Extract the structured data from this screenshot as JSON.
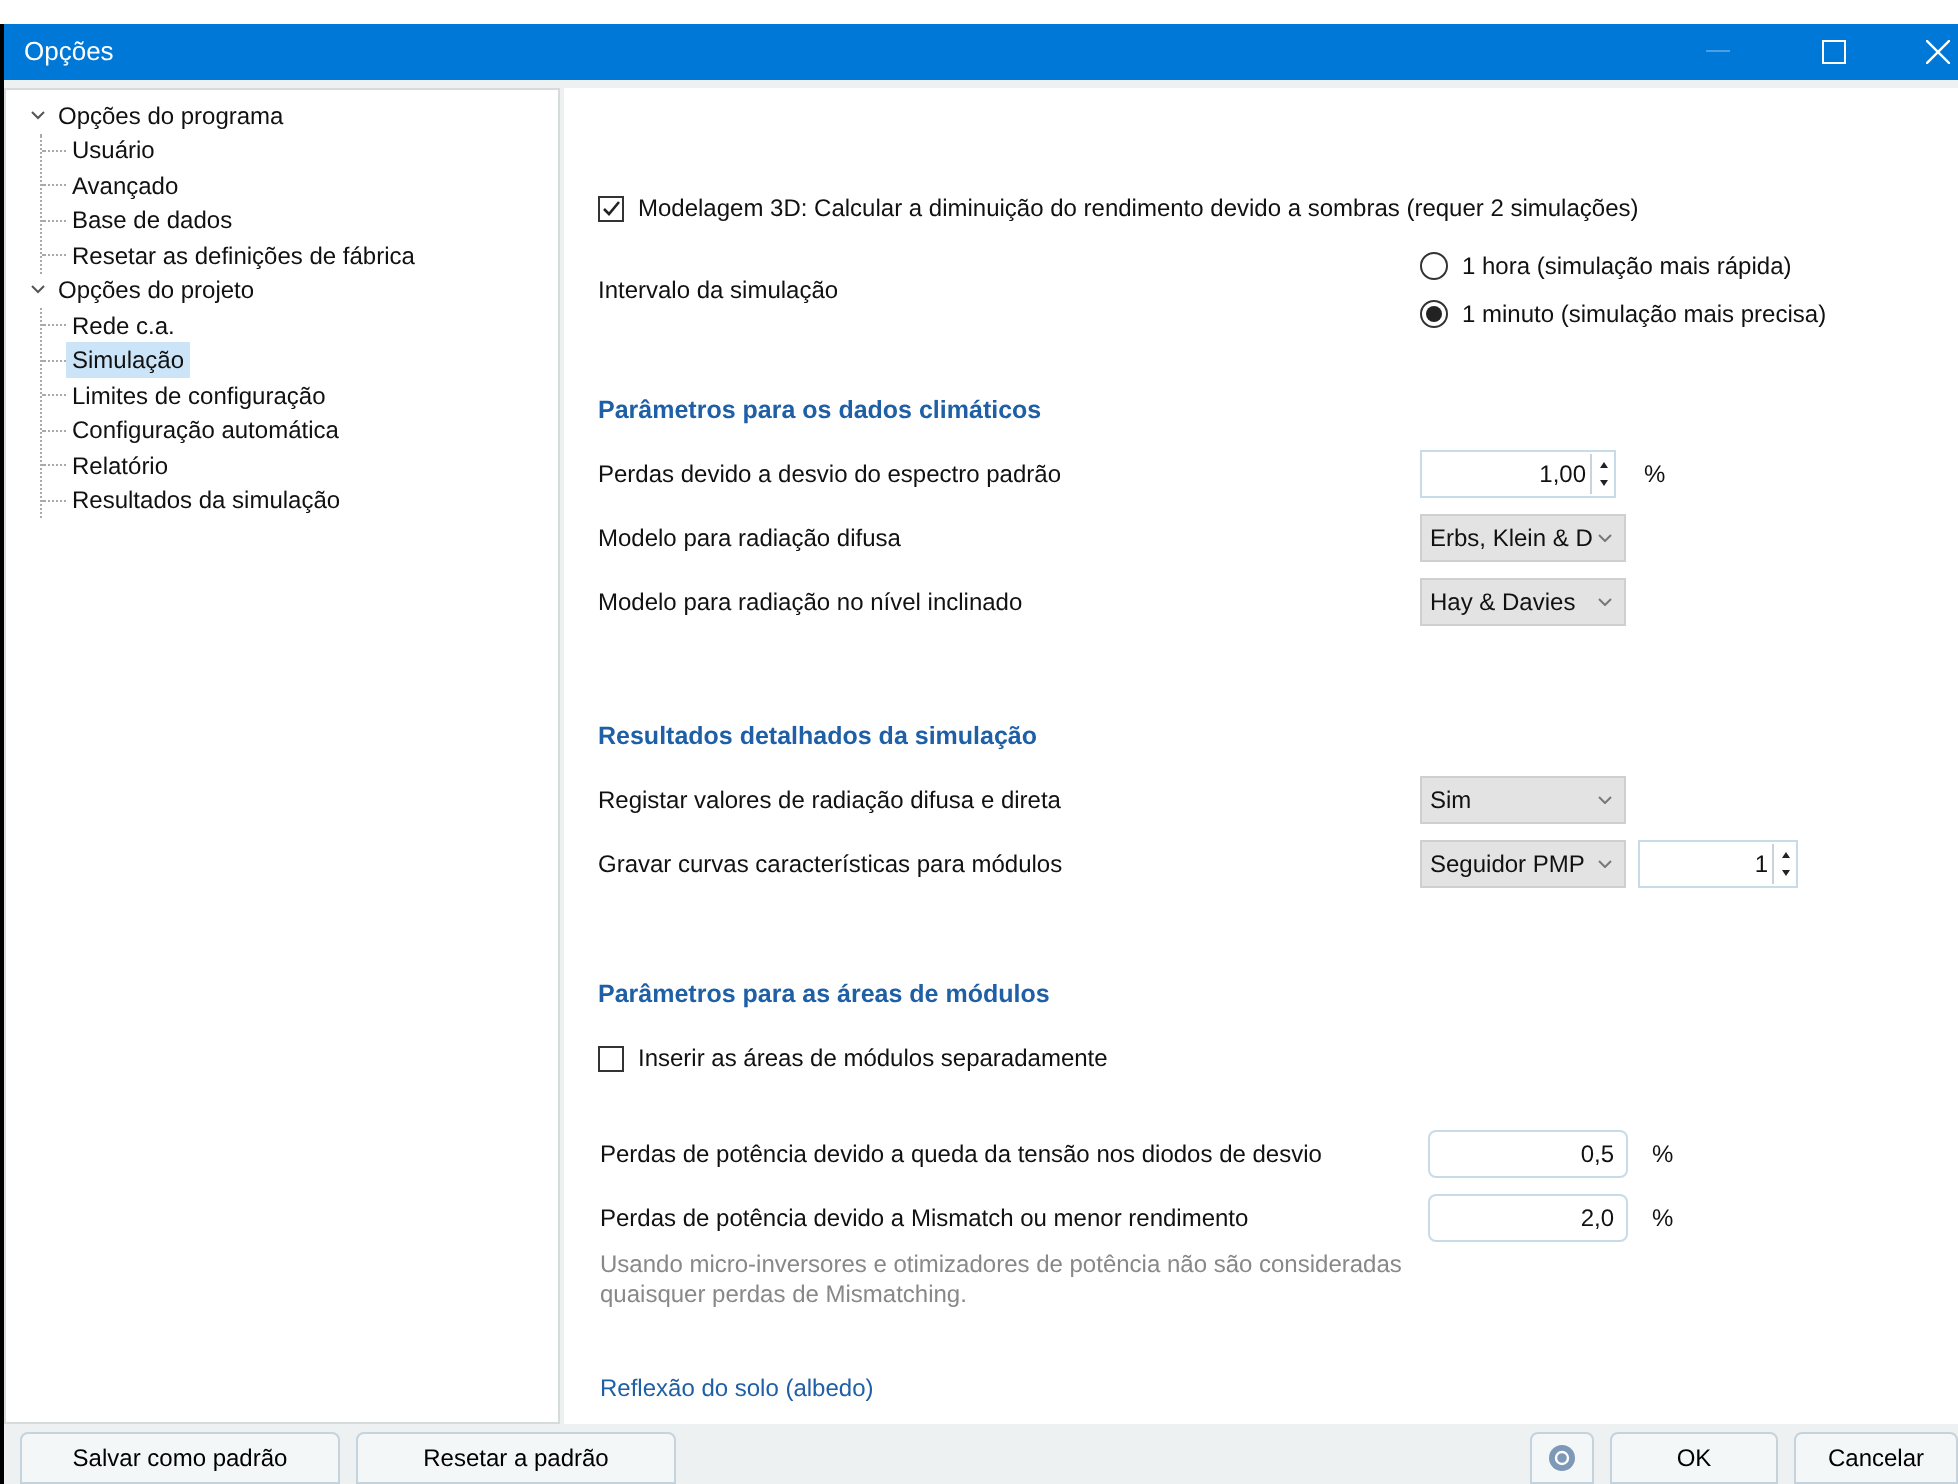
{
  "window": {
    "title": "Opções"
  },
  "tree": [
    {
      "label": "Opções do programa",
      "expanded": true,
      "children": [
        {
          "label": "Usuário",
          "selected": false
        },
        {
          "label": "Avançado",
          "selected": false
        },
        {
          "label": "Base de dados",
          "selected": false
        },
        {
          "label": "Resetar as definições de fábrica",
          "selected": false
        }
      ]
    },
    {
      "label": "Opções do projeto",
      "expanded": true,
      "children": [
        {
          "label": "Rede c.a.",
          "selected": false
        },
        {
          "label": "Simulação",
          "selected": true
        },
        {
          "label": "Limites de configuração",
          "selected": false
        },
        {
          "label": "Configuração automática",
          "selected": false
        },
        {
          "label": "Relatório",
          "selected": false
        },
        {
          "label": "Resultados da simulação",
          "selected": false
        }
      ]
    }
  ],
  "sections": [
    {
      "rows": [
        {
          "kind": "checkbox",
          "label": "Modelagem 3D: Calcular a diminuição do rendimento devido a sombras (requer 2 simulações)",
          "checked": true
        },
        {
          "kind": "radio",
          "label": "Intervalo da simulação",
          "options": [
            {
              "label": "1 hora (simulação mais rápida)",
              "selected": false
            },
            {
              "label": "1 minuto (simulação mais precisa)",
              "selected": true
            }
          ]
        }
      ]
    },
    {
      "title": "Parâmetros para os dados climáticos",
      "rows": [
        {
          "kind": "spin",
          "label": "Perdas devido a desvio do espectro padrão",
          "value": "1,00",
          "unit": "%"
        },
        {
          "kind": "select",
          "label": "Modelo para radiação difusa",
          "value": "Erbs, Klein & D"
        },
        {
          "kind": "select",
          "label": "Modelo para radiação no nível inclinado",
          "value": "Hay & Davies"
        }
      ]
    },
    {
      "title": "Resultados detalhados da simulação",
      "rows": [
        {
          "kind": "select",
          "label": "Registar valores de radiação difusa e direta",
          "value": "Sim"
        },
        {
          "kind": "select_spin",
          "label": "Gravar curvas características para módulos",
          "value": "Seguidor PMP",
          "count": "1"
        }
      ]
    },
    {
      "title": "Parâmetros para as áreas de módulos",
      "rows": [
        {
          "kind": "checkbox",
          "label": "Inserir as áreas de módulos separadamente",
          "checked": false
        },
        {
          "kind": "number",
          "label": "Perdas de potência devido a queda da tensão nos diodos de desvio",
          "value": "0,5",
          "unit": "%"
        },
        {
          "kind": "number",
          "label": "Perdas de potência devido a Mismatch ou menor rendimento",
          "value": "2,0",
          "unit": "%"
        },
        {
          "kind": "note",
          "label": "Usando micro-inversores e otimizadores de potência não são consideradas quaisquer perdas de Mismatching."
        },
        {
          "kind": "link",
          "label": "Reflexão do solo (albedo)"
        }
      ]
    }
  ],
  "footer": {
    "left_buttons": [
      "Salvar como padrão",
      "Resetar a padrão"
    ],
    "ok": "OK",
    "cancel": "Cancelar"
  }
}
